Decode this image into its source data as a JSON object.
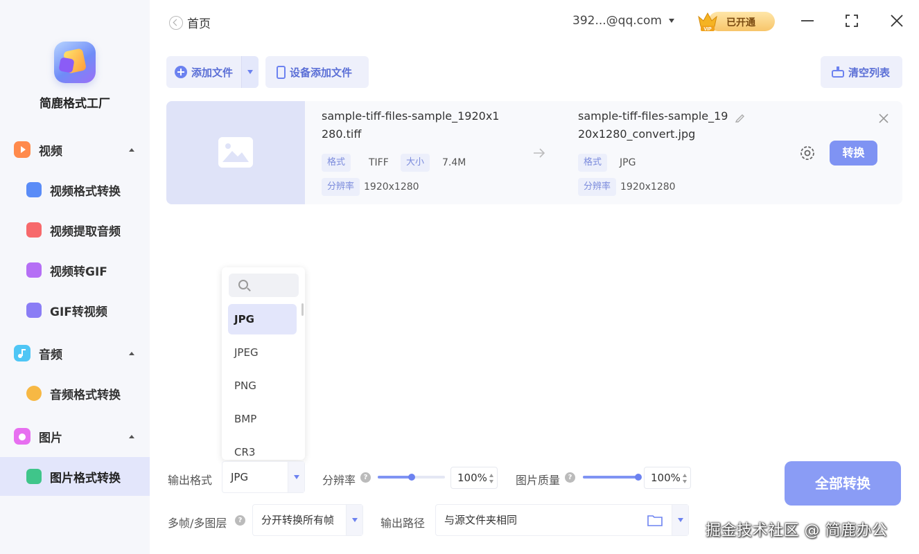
{
  "app": {
    "name": "简鹿格式工厂"
  },
  "sidebar": {
    "groups": [
      {
        "label": "视频",
        "icon": "video-icon",
        "color": "#ff8a4c",
        "items": [
          {
            "label": "视频格式转换",
            "icon": "video-convert-icon",
            "color": "#5a8cf7"
          },
          {
            "label": "视频提取音频",
            "icon": "music-note-icon",
            "color": "#f7696b"
          },
          {
            "label": "视频转GIF",
            "icon": "gif-icon",
            "color": "#b56ff5"
          },
          {
            "label": "GIF转视频",
            "icon": "gif-video-icon",
            "color": "#8a7df5"
          }
        ]
      },
      {
        "label": "音频",
        "icon": "audio-icon",
        "color": "#4fc6f5",
        "items": [
          {
            "label": "音频格式转换",
            "icon": "headphones-icon",
            "color": "#f7b844"
          }
        ]
      },
      {
        "label": "图片",
        "icon": "image-icon",
        "color": "#e76ff0",
        "items": [
          {
            "label": "图片格式转换",
            "icon": "image-convert-icon",
            "color": "#3fc58a",
            "active": true
          }
        ]
      }
    ]
  },
  "header": {
    "back_label": "首页",
    "account": "392...@qq.com",
    "vip_label": "已开通",
    "vip_badge": "VIP"
  },
  "toolbar": {
    "add_file": "添加文件",
    "device_add": "设备添加文件",
    "clear_list": "清空列表"
  },
  "file": {
    "source_name_line1": "sample-tiff-files-sample_1920x1",
    "source_name_line2": "280.tiff",
    "source_format_tag": "格式",
    "source_format": "TIFF",
    "source_size_tag": "大小",
    "source_size": "7.4M",
    "source_res_tag": "分辨率",
    "source_res": "1920x1280",
    "output_name_line1": "sample-tiff-files-sample_19",
    "output_name_line2": "20x1280_convert.jpg",
    "output_format_tag": "格式",
    "output_format": "JPG",
    "output_res_tag": "分辨率",
    "output_res": "1920x1280",
    "convert_label": "转换"
  },
  "format_dropdown": {
    "options": [
      "JPG",
      "JPEG",
      "PNG",
      "BMP",
      "CR3"
    ],
    "selected": "JPG"
  },
  "controls": {
    "output_format_label": "输出格式",
    "output_format_value": "JPG",
    "resolution_label": "分辨率",
    "resolution_value": "100%",
    "resolution_level": 0.5,
    "quality_label": "图片质量",
    "quality_value": "100%",
    "quality_level": 1.0,
    "multiframe_label": "多帧/多图层",
    "multiframe_value": "分开转换所有帧",
    "output_path_label": "输出路径",
    "output_path_value": "与源文件夹相同",
    "help_glyph": "?",
    "convert_all": "全部转换"
  },
  "watermark": "掘金技术社区 @ 简鹿办公",
  "colors": {
    "accent": "#7f93f3",
    "sidebar_bg": "#f6f7fb",
    "active_bg": "#e3e6fb"
  }
}
